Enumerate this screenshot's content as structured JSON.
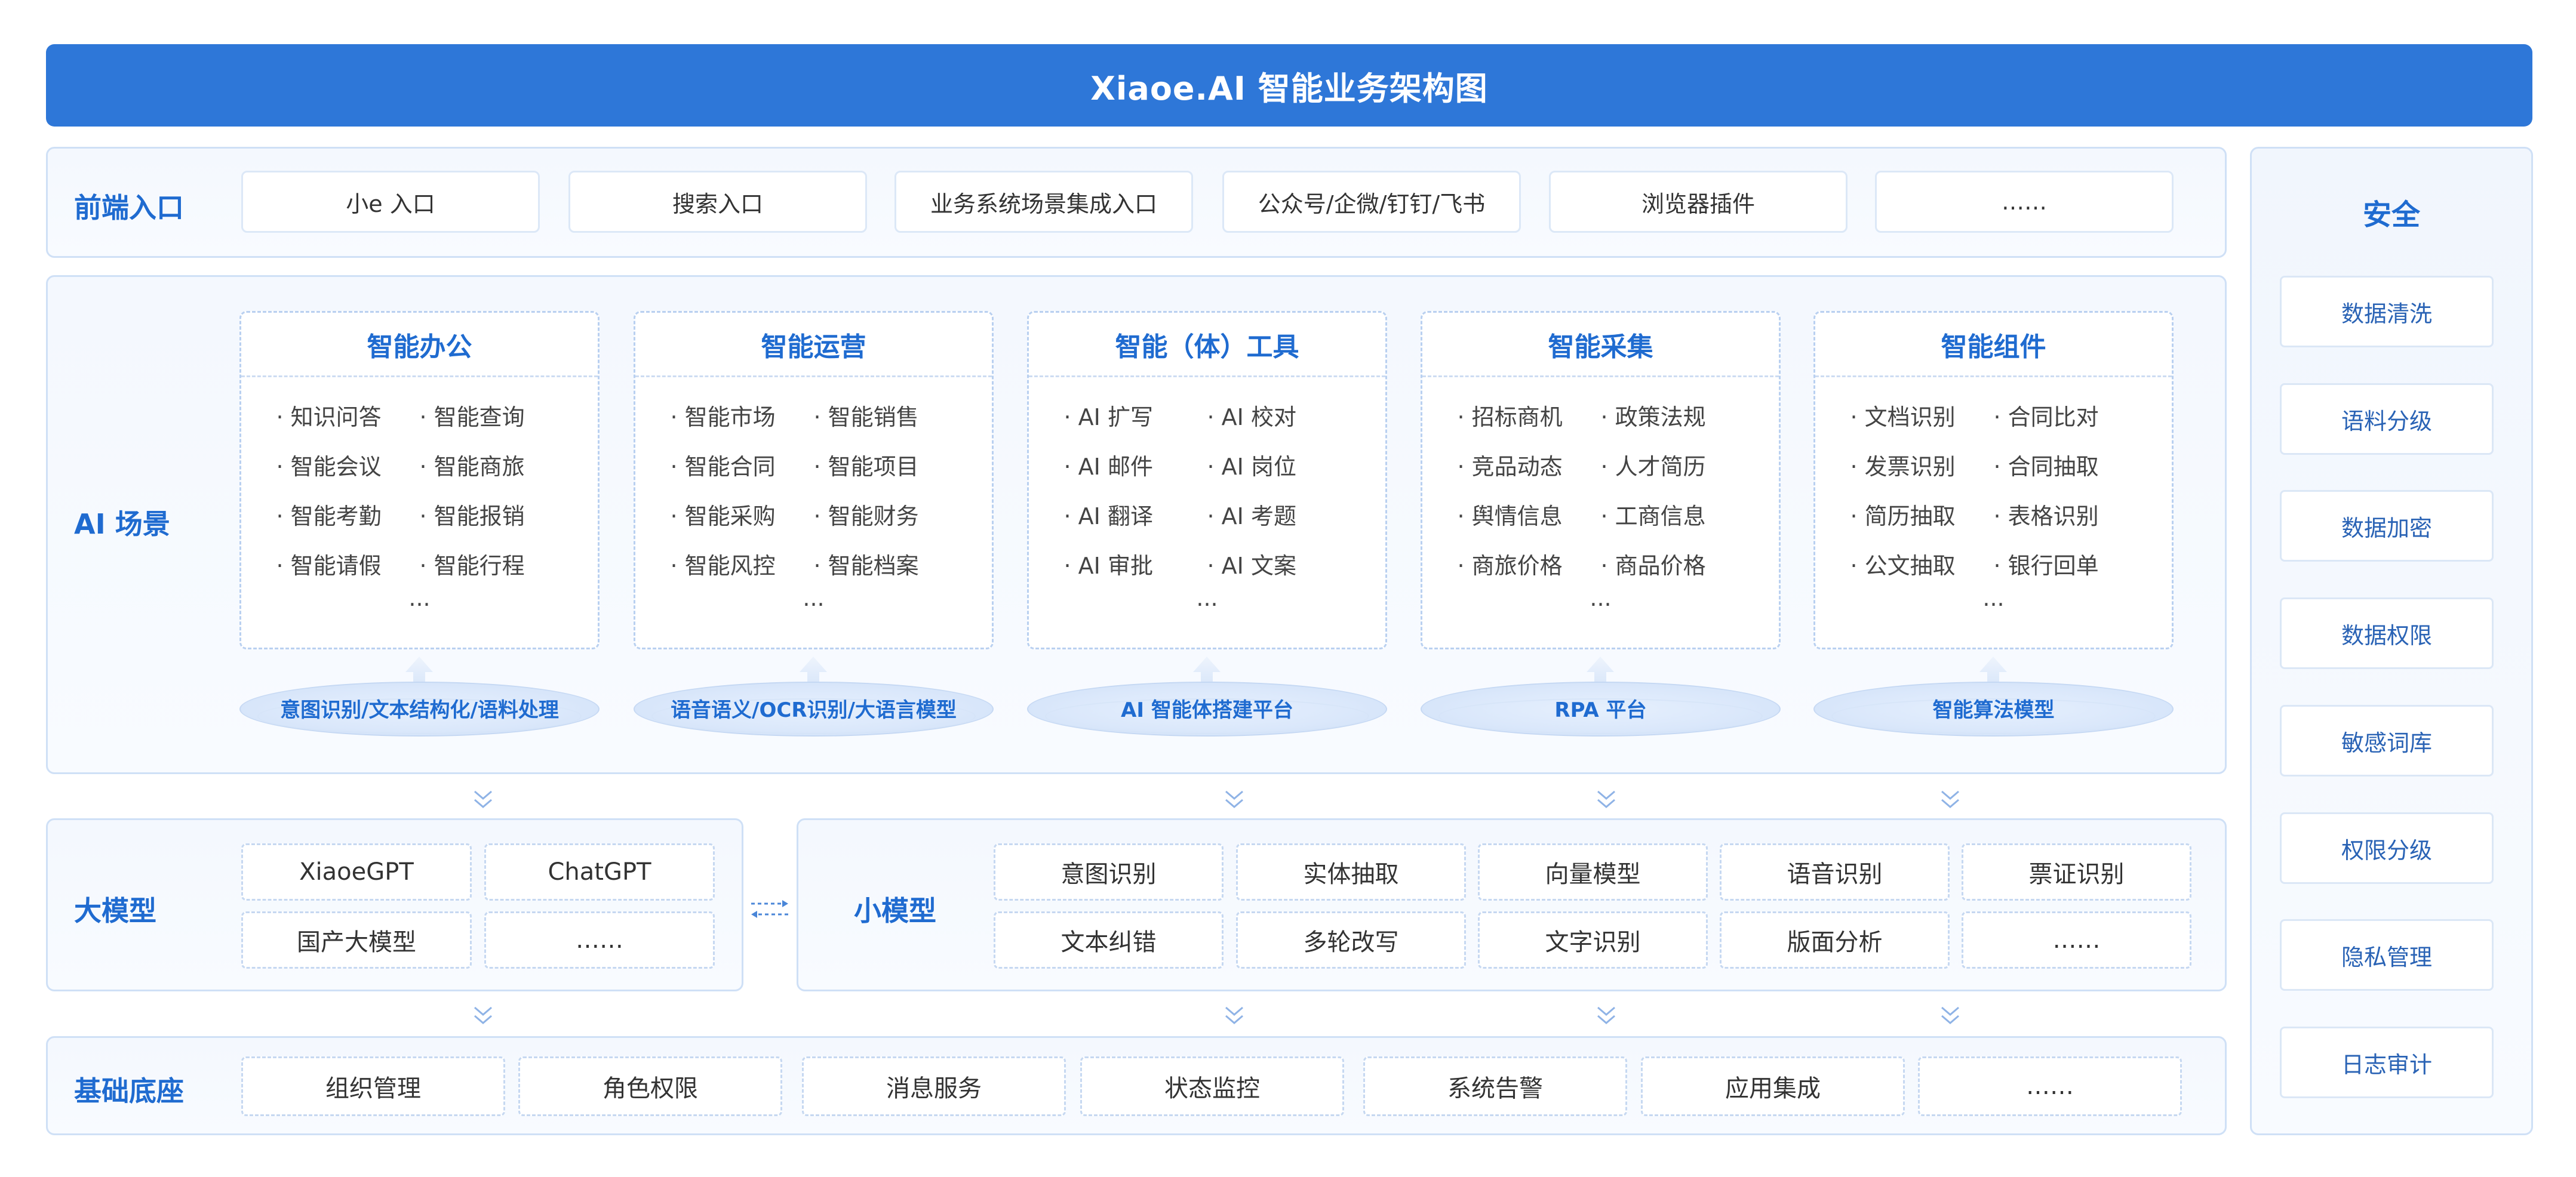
{
  "title": "Xiaoe.AI 智能业务架构图",
  "frontend": {
    "label": "前端入口",
    "entries": [
      "小e 入口",
      "搜索入口",
      "业务系统场景集成入口",
      "公众号/企微/钉钉/飞书",
      "浏览器插件",
      "……"
    ]
  },
  "ai_scene": {
    "label": "AI 场景",
    "cards": [
      {
        "title": "智能办公",
        "items": [
          "· 知识问答",
          "· 智能查询",
          "· 智能会议",
          "· 智能商旅",
          "· 智能考勤",
          "· 智能报销",
          "· 智能请假",
          "· 智能行程"
        ],
        "more": "..."
      },
      {
        "title": "智能运营",
        "items": [
          "· 智能市场",
          "· 智能销售",
          "· 智能合同",
          "· 智能项目",
          "· 智能采购",
          "· 智能财务",
          "· 智能风控",
          "· 智能档案"
        ],
        "more": "..."
      },
      {
        "title": "智能（体）工具",
        "items": [
          "· AI 扩写",
          "· AI 校对",
          "· AI 邮件",
          "· AI 岗位",
          "· AI 翻译",
          "· AI 考题",
          "· AI 审批",
          "· AI 文案"
        ],
        "more": "..."
      },
      {
        "title": "智能采集",
        "items": [
          "· 招标商机",
          "· 政策法规",
          "· 竞品动态",
          "· 人才简历",
          "· 舆情信息",
          "· 工商信息",
          "· 商旅价格",
          "· 商品价格"
        ],
        "more": "..."
      },
      {
        "title": "智能组件",
        "items": [
          "· 文档识别",
          "· 合同比对",
          "· 发票识别",
          "· 合同抽取",
          "· 简历抽取",
          "· 表格识别",
          "· 公文抽取",
          "· 银行回单"
        ],
        "more": "..."
      }
    ],
    "platforms": [
      "意图识别/文本结构化/语料处理",
      "语音语义/OCR识别/大语言模型",
      "AI 智能体搭建平台",
      "RPA 平台",
      "智能算法模型"
    ]
  },
  "large_model": {
    "label": "大模型",
    "items": [
      "XiaoeGPT",
      "ChatGPT",
      "国产大模型",
      "……"
    ]
  },
  "small_model": {
    "label": "小模型",
    "items": [
      "意图识别",
      "实体抽取",
      "向量模型",
      "语音识别",
      "票证识别",
      "文本纠错",
      "多轮改写",
      "文字识别",
      "版面分析",
      "……"
    ]
  },
  "foundation": {
    "label": "基础底座",
    "items": [
      "组织管理",
      "角色权限",
      "消息服务",
      "状态监控",
      "系统告警",
      "应用集成",
      "……"
    ]
  },
  "security": {
    "label": "安全",
    "items": [
      "数据清洗",
      "语料分级",
      "数据加密",
      "数据权限",
      "敏感词库",
      "权限分级",
      "隐私管理",
      "日志审计"
    ]
  },
  "colors": {
    "primary": "#2e77d8",
    "accent_text": "#1f6bd0",
    "panel_border": "#cfe0f6"
  }
}
